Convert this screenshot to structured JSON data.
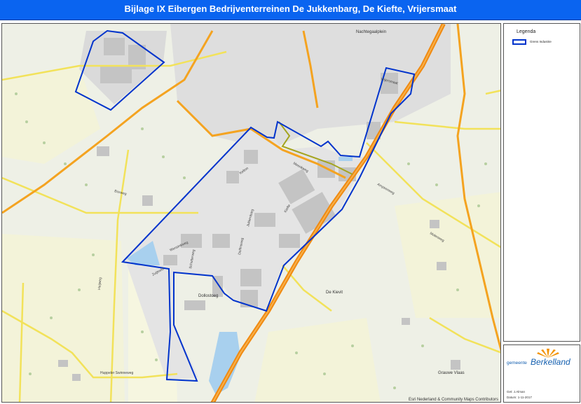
{
  "title": "Bijlage IX   Eibergen Bedrijventerreinen De Jukkenbarg, De Kiefte, Vrijersmaat",
  "legend": {
    "title": "Legenda",
    "item_label": "Grens Industrie",
    "boundary_color": "#0033cc"
  },
  "logo": {
    "prefix": "gemeente",
    "name": "Berkelland",
    "brand_color": "#1560b0",
    "ray_color": "#f39200"
  },
  "meta": {
    "author_label": "Get: J.Alman",
    "date_label": "Datum: 1-11-2017"
  },
  "credit": "Esri Nederland & Community Maps Contributors",
  "map_labels": {
    "nachtegaalplein": "Nachtegaalplein",
    "de_kievit": "De Kievit",
    "dollostoeg": "Dollostoeg",
    "grauwe_vlaas": "Grauwe Vlaas",
    "wensinkweg": "Wensinkweg",
    "kelton": "Kelton",
    "schutterweg": "Schutterweg",
    "zuijtveld": "Zuijtveld",
    "huppeler_swinneweg": "Huppeler Swinneweg",
    "jukkenbarg": "Jukkenbarg",
    "dolfinsweg": "Dolfinsweg",
    "kiefte": "Kiefte",
    "ampsenweg": "Ampsenweg",
    "molenweg": "Molenweg",
    "bosweg": "Bosweg",
    "heijweg": "Heijweg",
    "meenkweg": "Meenkweg",
    "vrijersmaat": "Vrijersmaat"
  },
  "colors": {
    "main_road": "#f4a320",
    "secondary_road": "#f2e25a",
    "water": "#a8d0ee",
    "field": "#f2f2d8",
    "urban": "#dcdcdc",
    "building": "#bdbdbd"
  }
}
